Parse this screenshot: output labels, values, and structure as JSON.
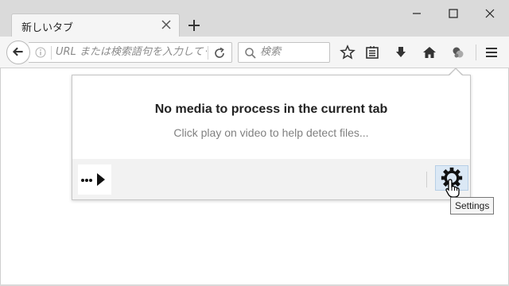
{
  "browser": {
    "tab": {
      "title": "新しいタブ"
    },
    "urlbar": {
      "placeholder": "URL または検索語句を入力してください"
    },
    "searchbar": {
      "placeholder": "検索"
    },
    "icons": [
      "back-icon",
      "info-icon",
      "reload-icon",
      "search-icon",
      "star-icon",
      "reading-list-icon",
      "download-icon",
      "home-icon",
      "extension-icon",
      "menu-icon"
    ]
  },
  "popup": {
    "heading": "No media to process in the current tab",
    "subtext": "Click play on video to help detect files...",
    "tooltip": "Settings"
  },
  "colors": {
    "titlebar": "#dadada",
    "navbar": "#f5f5f5",
    "accent_hover": "#dbe8f5"
  }
}
